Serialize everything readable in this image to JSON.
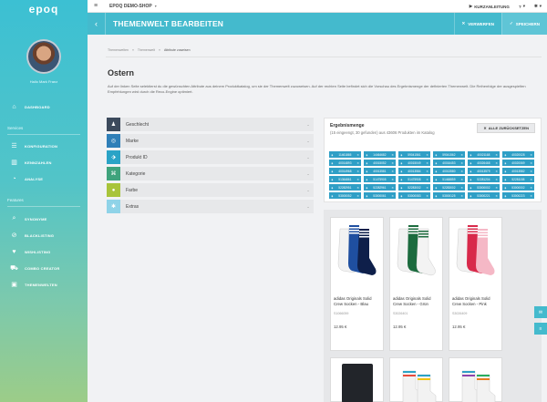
{
  "app": {
    "logo": "epoq"
  },
  "user": {
    "name": "Hallo Mark Franz"
  },
  "sidebar": {
    "nav_top": [
      {
        "label": "DASHBOARD",
        "icon": "home-icon"
      }
    ],
    "sections": [
      {
        "title": "Services",
        "items": [
          {
            "label": "KONFIGURATION",
            "icon": "sliders-icon"
          },
          {
            "label": "KENNZAHLEN",
            "icon": "chart-bar-icon"
          },
          {
            "label": "ANALYSE",
            "icon": "pie-chart-icon"
          }
        ]
      },
      {
        "title": "Features",
        "items": [
          {
            "label": "SYNONYME",
            "icon": "search-icon"
          },
          {
            "label": "BLACKLISTING",
            "icon": "ban-icon"
          },
          {
            "label": "WISHLISTING",
            "icon": "heart-icon"
          },
          {
            "label": "COMBO CREATOR",
            "icon": "car-icon"
          },
          {
            "label": "THEMENWELTEN",
            "icon": "image-icon"
          }
        ]
      }
    ]
  },
  "topbar": {
    "shop": "EPOQ DEMO-SHOP",
    "help": "KURZANLEITUNG"
  },
  "header": {
    "title": "THEMENWELT BEARBEITEN",
    "discard": "VERWERFEN",
    "save": "SPEICHERN"
  },
  "breadcrumb": [
    "Themenwelten",
    "Themenwelt",
    "Attribute zuweisen"
  ],
  "page": {
    "heading": "Ostern",
    "description": "Auf der linken Seite selektierst du die gewünschten Attribute aus deinem Produktkatalog, um sie der Themenwelt zuzuweisen. Auf der rechten Seite befindet sich die Vorschau des Ergebnismenge der definierten Themenwelt. Die Reihenfolge der ausgespielten Empfehlungen wird durch die Reco-Engine optimiert."
  },
  "filters": [
    {
      "label": "Geschlecht",
      "icon": "person-icon",
      "color": "#3c4a5c"
    },
    {
      "label": "Marke",
      "icon": "target-icon",
      "color": "#2f7fb8"
    },
    {
      "label": "Produkt ID",
      "icon": "tag-icon",
      "color": "#2aa3c6"
    },
    {
      "label": "Kategorie",
      "icon": "sitemap-icon",
      "color": "#3fa37c"
    },
    {
      "label": "Farbe",
      "icon": "drop-icon",
      "color": "#a8c43a"
    },
    {
      "label": "Extras",
      "icon": "star-icon",
      "color": "#8fd3e8"
    }
  ],
  "results": {
    "title": "Ergebnismenge",
    "subtitle": "(15 eingeengt, 30 gefunden) aus 43606 Produkten im Katalog",
    "reset": "ALLE ZURÜCKSETZEN",
    "tags": [
      "11461865",
      "14464682",
      "59041561",
      "59041562",
      "40021168",
      "40020028",
      "40014893",
      "40015052",
      "40015049",
      "40016453",
      "40026468",
      "40020069",
      "40014968",
      "40013581",
      "40013584",
      "40013580",
      "40013579",
      "40013582",
      "51364861",
      "51475905",
      "51475908",
      "51468859",
      "52281204",
      "52281158",
      "52282951",
      "52282961",
      "52283002",
      "52283002",
      "53000002",
      "53000002",
      "53000052",
      "53000061",
      "53000083",
      "53000125",
      "53000221",
      "53000223"
    ]
  },
  "products": [
    {
      "name": "adidas Originals Solid Crew Socken - Blau",
      "sku": "S1066059",
      "price": "12.95 €"
    },
    {
      "name": "adidas Originals Solid Crew Socken - Grün",
      "sku": "S3026401",
      "price": "12.95 €"
    },
    {
      "name": "adidas Originals Solid Crew Socken - Pink",
      "sku": "S3026409",
      "price": "12.95 €"
    },
    {
      "name": "",
      "sku": "",
      "price": ""
    },
    {
      "name": "",
      "sku": "",
      "price": ""
    },
    {
      "name": "",
      "sku": "",
      "price": ""
    }
  ],
  "colors": {
    "accent": "#44bacd",
    "tag": "#2f9fc6"
  }
}
